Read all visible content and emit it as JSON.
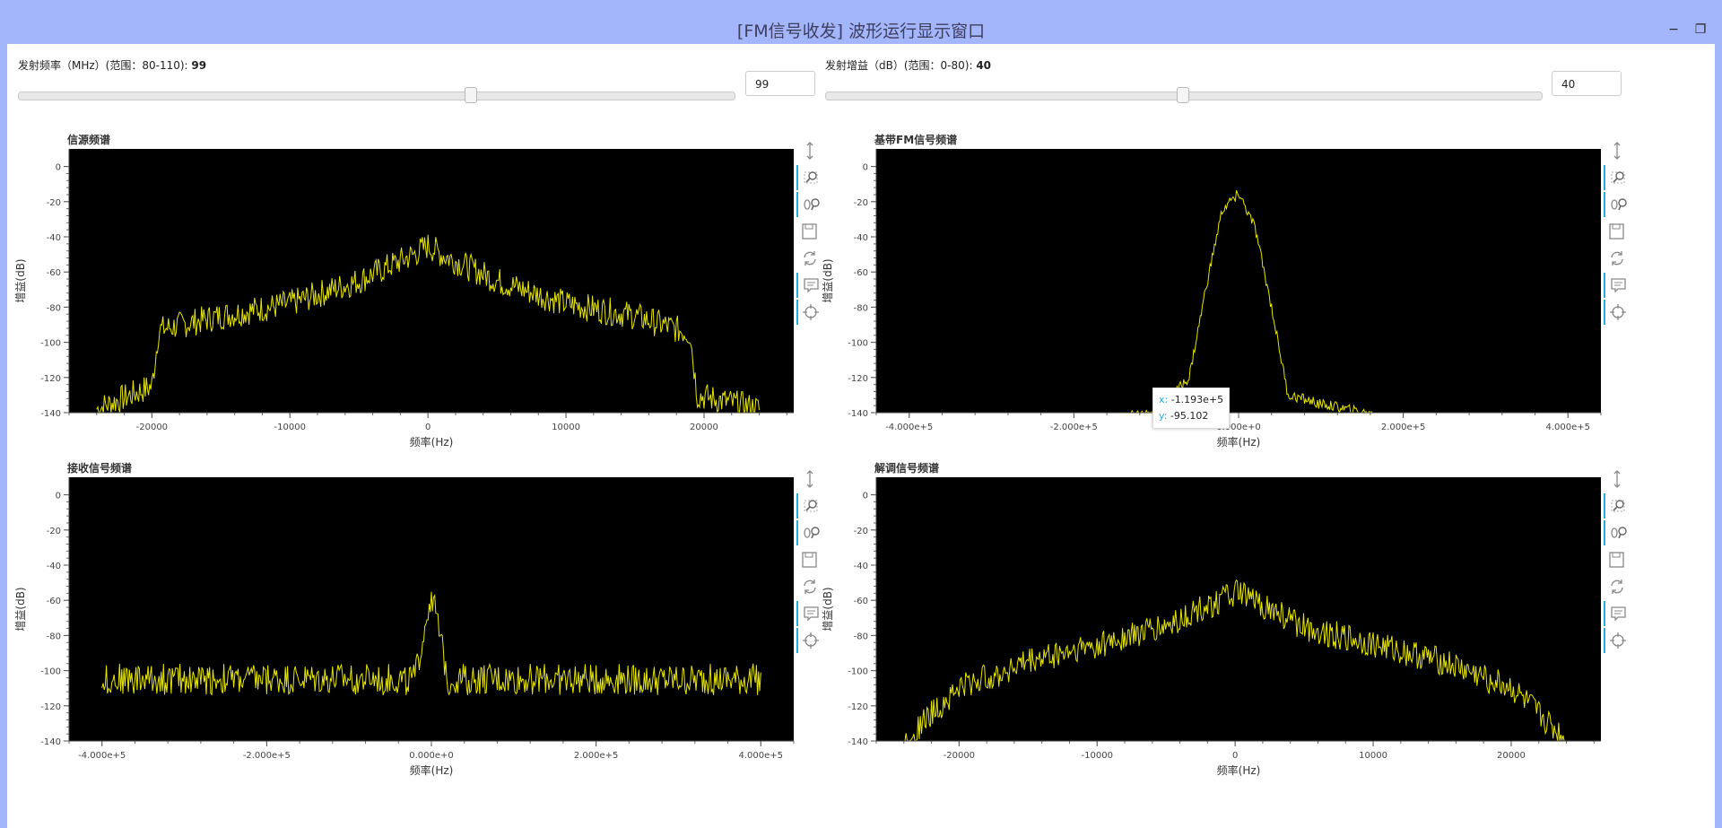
{
  "window": {
    "title": "[FM信号收发] 波形运行显示窗口",
    "minimize_glyph": "−",
    "restore_glyph": "❐"
  },
  "freq_control": {
    "label": "发射频率（MHz）(范围：80-110):",
    "value": "99",
    "min": 80,
    "max": 110
  },
  "gain_control": {
    "label": "发射增益（dB）(范围：0-80):",
    "value": "40",
    "min": 0,
    "max": 80
  },
  "tools": [
    "box-zoom-y-icon",
    "box-zoom-icon",
    "wheel-zoom-icon",
    "save-icon",
    "reset-icon",
    "hover-icon",
    "crosshair-icon"
  ],
  "colors": {
    "trace": "#e6e600",
    "plot_bg": "#000000",
    "tool_active": "#26aae1"
  },
  "tooltip": {
    "x_label": "x:",
    "x_value": "-1.193e+5",
    "y_label": "y:",
    "y_value": "-95.102"
  },
  "plots": [
    {
      "id": "source",
      "title": "信源频谱",
      "xlabel": "频率(Hz)",
      "ylabel": "增益(dB)",
      "xlim": [
        -26000,
        26500
      ],
      "ylim": [
        -140,
        10
      ],
      "xticks": [
        -20000,
        -10000,
        0,
        10000,
        20000
      ],
      "xtick_labels": [
        "-20000",
        "-10000",
        "0",
        "10000",
        "20000"
      ],
      "yticks": [
        0,
        -20,
        -40,
        -60,
        -80,
        -100,
        -120,
        -140
      ],
      "chart_data": {
        "type": "line",
        "series": [
          {
            "x": [
              -24000,
              -20000,
              -19500,
              -15000,
              -10000,
              -5000,
              -1000,
              0,
              1000,
              5000,
              10000,
              15000,
              19000,
              19500,
              24000
            ],
            "y": [
              -138,
              -125,
              -93,
              -85,
              -78,
              -65,
              -50,
              -45,
              -50,
              -65,
              -78,
              -85,
              -95,
              -130,
              -138
            ],
            "noise": 8
          }
        ]
      }
    },
    {
      "id": "baseband",
      "title": "基带FM信号频谱",
      "xlabel": "频率(Hz)",
      "ylabel": "增益(dB)",
      "xlim": [
        -440000,
        440000
      ],
      "ylim": [
        -140,
        10
      ],
      "xticks": [
        -400000,
        -200000,
        0,
        200000,
        400000
      ],
      "xtick_labels": [
        "-4.000e+5",
        "-2.000e+5",
        "0.000e+0",
        "2.000e+5",
        "4.000e+5"
      ],
      "yticks": [
        0,
        -20,
        -40,
        -60,
        -80,
        -100,
        -120,
        -140
      ],
      "chart_data": {
        "type": "line",
        "series": [
          {
            "x": [
              -400000,
              -200000,
              -100000,
              -60000,
              -40000,
              -20000,
              0,
              20000,
              40000,
              60000,
              100000,
              200000,
              400000
            ],
            "y": [
              -145,
              -145,
              -140,
              -120,
              -70,
              -25,
              -15,
              -35,
              -80,
              -130,
              -135,
              -145,
              -145
            ],
            "noise": 3
          }
        ]
      }
    },
    {
      "id": "received",
      "title": "接收信号频谱",
      "xlabel": "频率(Hz)",
      "ylabel": "增益(dB)",
      "xlim": [
        -440000,
        440000
      ],
      "ylim": [
        -140,
        10
      ],
      "xticks": [
        -400000,
        -200000,
        0,
        200000,
        400000
      ],
      "xtick_labels": [
        "-4.000e+5",
        "-2.000e+5",
        "0.000e+0",
        "2.000e+5",
        "4.000e+5"
      ],
      "yticks": [
        0,
        -20,
        -40,
        -60,
        -80,
        -100,
        -120,
        -140
      ],
      "chart_data": {
        "type": "line",
        "series": [
          {
            "x": [
              -400000,
              -20000,
              -10000,
              0,
              10000,
              20000,
              400000
            ],
            "y": [
              -105,
              -105,
              -80,
              -55,
              -80,
              -105,
              -105
            ],
            "noise": 9
          }
        ]
      }
    },
    {
      "id": "demod",
      "title": "解调信号频谱",
      "xlabel": "频率(Hz)",
      "ylabel": "增益(dB)",
      "xlim": [
        -26000,
        26500
      ],
      "ylim": [
        -140,
        10
      ],
      "xticks": [
        -20000,
        -10000,
        0,
        10000,
        20000
      ],
      "xtick_labels": [
        "-20000",
        "-10000",
        "0",
        "10000",
        "20000"
      ],
      "yticks": [
        0,
        -20,
        -40,
        -60,
        -80,
        -100,
        -120,
        -140
      ],
      "chart_data": {
        "type": "line",
        "series": [
          {
            "x": [
              -24000,
              -20000,
              -15000,
              -10000,
              -5000,
              0,
              5000,
              10000,
              15000,
              20000,
              24000
            ],
            "y": [
              -140,
              -110,
              -95,
              -85,
              -75,
              -55,
              -75,
              -85,
              -95,
              -110,
              -140
            ],
            "noise": 8
          }
        ]
      }
    }
  ]
}
